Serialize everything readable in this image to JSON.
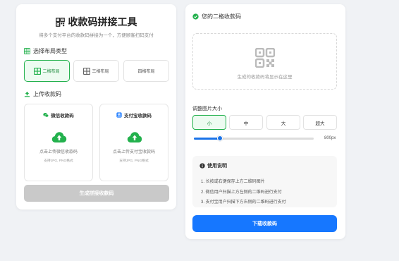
{
  "left": {
    "title": "收款码拼接工具",
    "subtitle": "将多个支付平台的收款码拼接为一个，方便顾客扫码支付",
    "layout_section": "选择布局类型",
    "layouts": [
      {
        "label": "二格布局",
        "active": true
      },
      {
        "label": "三格布局",
        "active": false
      },
      {
        "label": "四格布局",
        "active": false
      }
    ],
    "upload_section": "上传收款码",
    "uploads": [
      {
        "title": "微信收款码",
        "text": "点击上传微信收款码",
        "hint": "支持JPG, PNG格式",
        "icon": "wechat-icon"
      },
      {
        "title": "支付宝收款码",
        "text": "点击上传支付宝收款码",
        "hint": "支持JPG, PNG格式",
        "icon": "alipay-icon"
      }
    ],
    "generate_label": "生成拼接收款码"
  },
  "right": {
    "title": "您的二格收款码",
    "preview_text": "生成的收款码将显示在这里",
    "size_label": "调整图片大小",
    "sizes": [
      {
        "label": "小",
        "active": true
      },
      {
        "label": "中",
        "active": false
      },
      {
        "label": "大",
        "active": false
      },
      {
        "label": "超大",
        "active": false
      }
    ],
    "slider_value": "800px",
    "slider_fraction": 0.22,
    "instructions_title": "使用说明",
    "instructions": [
      "1. 长按或右键保存上方二维码图片",
      "2. 微信用户扫描上方左侧的二维码进行支付",
      "3. 支付宝用户扫描下方右侧的二维码进行支付"
    ],
    "download_label": "下载收款码"
  },
  "colors": {
    "green": "#23b14d",
    "blue": "#1677ff",
    "disabled": "#c9c9c9"
  }
}
